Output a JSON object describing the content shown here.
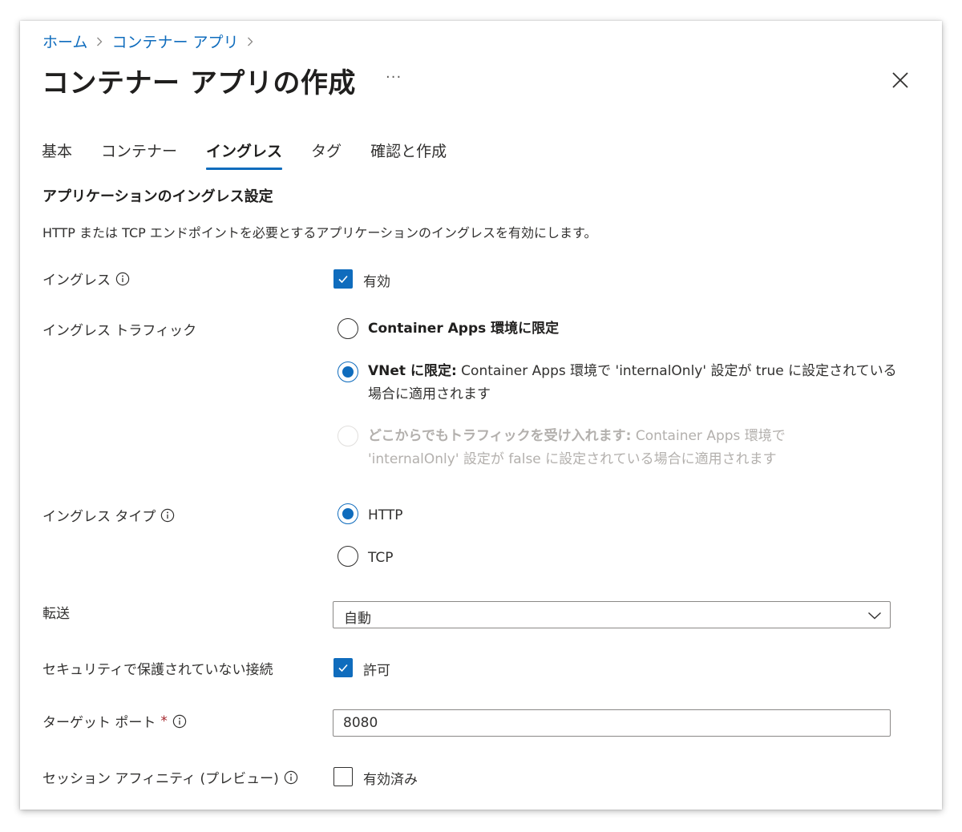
{
  "breadcrumb": {
    "items": [
      "ホーム",
      "コンテナー アプリ"
    ]
  },
  "header": {
    "title": "コンテナー アプリの作成",
    "more": "···"
  },
  "tabs": [
    {
      "label": "基本",
      "active": false
    },
    {
      "label": "コンテナー",
      "active": false
    },
    {
      "label": "イングレス",
      "active": true
    },
    {
      "label": "タグ",
      "active": false
    },
    {
      "label": "確認と作成",
      "active": false
    }
  ],
  "section": {
    "title": "アプリケーションのイングレス設定",
    "description": "HTTP または TCP エンドポイントを必要とするアプリケーションのイングレスを有効にします。"
  },
  "ingress": {
    "label": "イングレス",
    "checkbox_label": "有効",
    "checked": true
  },
  "traffic": {
    "label": "イングレス トラフィック",
    "options": [
      {
        "lead": "Container Apps 環境に限定",
        "text": "",
        "selected": false,
        "disabled": false
      },
      {
        "lead": "VNet に限定:",
        "text": " Container Apps 環境で 'internalOnly' 設定が true に設定されている場合に適用されます",
        "selected": true,
        "disabled": false
      },
      {
        "lead": "どこからでもトラフィックを受け入れます:",
        "text": " Container Apps 環境で 'internalOnly' 設定が false に設定されている場合に適用されます",
        "selected": false,
        "disabled": true
      }
    ]
  },
  "ingress_type": {
    "label": "イングレス タイプ",
    "options": [
      {
        "label": "HTTP",
        "selected": true
      },
      {
        "label": "TCP",
        "selected": false
      }
    ]
  },
  "transport": {
    "label": "転送",
    "value": "自動"
  },
  "insecure": {
    "label": "セキュリティで保護されていない接続",
    "checkbox_label": "許可",
    "checked": true
  },
  "target_port": {
    "label": "ターゲット ポート",
    "required_mark": "*",
    "value": "8080"
  },
  "session_affinity": {
    "label": "セッション アフィニティ (プレビュー)",
    "checkbox_label": "有効済み",
    "checked": false
  },
  "icons": {
    "info": "info-icon",
    "close": "close-icon",
    "chevron": "chevron-down-icon",
    "crumb_separator": "chevron-right-icon"
  },
  "colors": {
    "accent": "#0f6cbd",
    "required": "#a4262c",
    "disabled_text": "#b3b0ad"
  }
}
